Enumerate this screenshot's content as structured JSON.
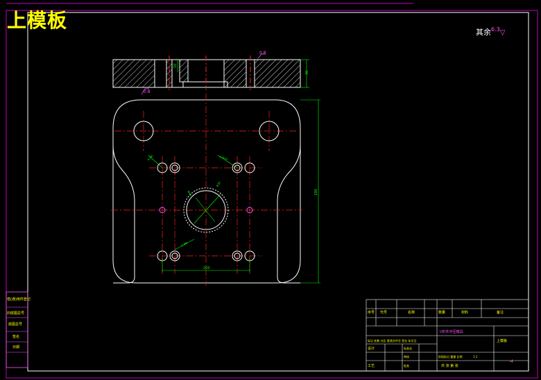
{
  "drawing": {
    "title": "上模板",
    "roughness_note": "其余",
    "roughness_value": "6.3",
    "surface_mark_top": "0.8",
    "surface_mark_bottom": "0.8"
  },
  "dimensions": {
    "thickness": "30",
    "counterbore_depth": "10",
    "width": "200",
    "height": "180",
    "d_guide_top_left": "4-Φ6",
    "d_guide_top_right": "4-Φ10",
    "d_center": "Φ40",
    "d_center_right": "Φ30",
    "d_pin": "2-Φ6"
  },
  "side_table": {
    "rows": [
      "借(通)用件登记",
      "旧底图总号",
      "底图总号",
      "签名",
      "日期"
    ]
  },
  "title_block": {
    "col_seq": "序号",
    "col_code": "代号",
    "col_name": "名称",
    "col_qty": "数量",
    "col_material": "材料",
    "col_note": "备注",
    "project_name": "U形件冲压模具",
    "part_name": "上模板",
    "row_marks": "标记 处数 分区 更改文件号 签名 年月日",
    "design": "设计",
    "standardize": "标准化",
    "review": "审核",
    "process": "工艺",
    "approve": "批准",
    "stage_labels": "阶段标记 重量 比例",
    "scale": "1:1",
    "sheet_info": "共 张 第 张",
    "drawing_no": "-4"
  }
}
